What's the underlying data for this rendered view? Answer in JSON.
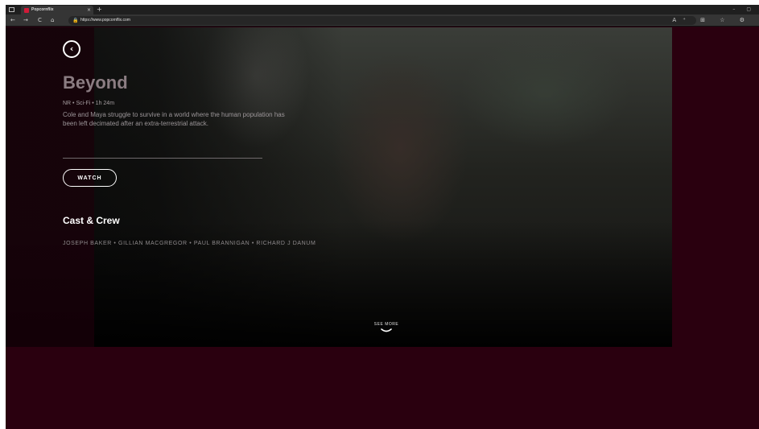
{
  "browser": {
    "tab_title": "Popcornflix",
    "tab_close": "×",
    "new_tab": "+",
    "window_controls": "–  ▢",
    "url": "https://www.popcornflix.com",
    "back": "←",
    "forward": "→",
    "reload": "C",
    "home": "⌂",
    "lock": "🔒",
    "toolbar_right": "A⁺ ⊞ ☆ ⚙"
  },
  "movie": {
    "back_label": "‹",
    "title": "Beyond",
    "meta": "NR • Sci-Fi • 1h 24m",
    "description": "Cole and Maya struggle to survive in a world where the human population has been left decimated after an extra-terrestrial attack.",
    "watch_label": "WATCH"
  },
  "cast": {
    "heading": "Cast & Crew",
    "list": "JOSEPH BAKER • GILLIAN MACGREGOR • PAUL BRANNIGAN • RICHARD J DANUM"
  },
  "see_more": {
    "label": "SEE MORE"
  },
  "colors": {
    "page_background": "#2a000f",
    "accent_favicon": "#d11a38"
  }
}
